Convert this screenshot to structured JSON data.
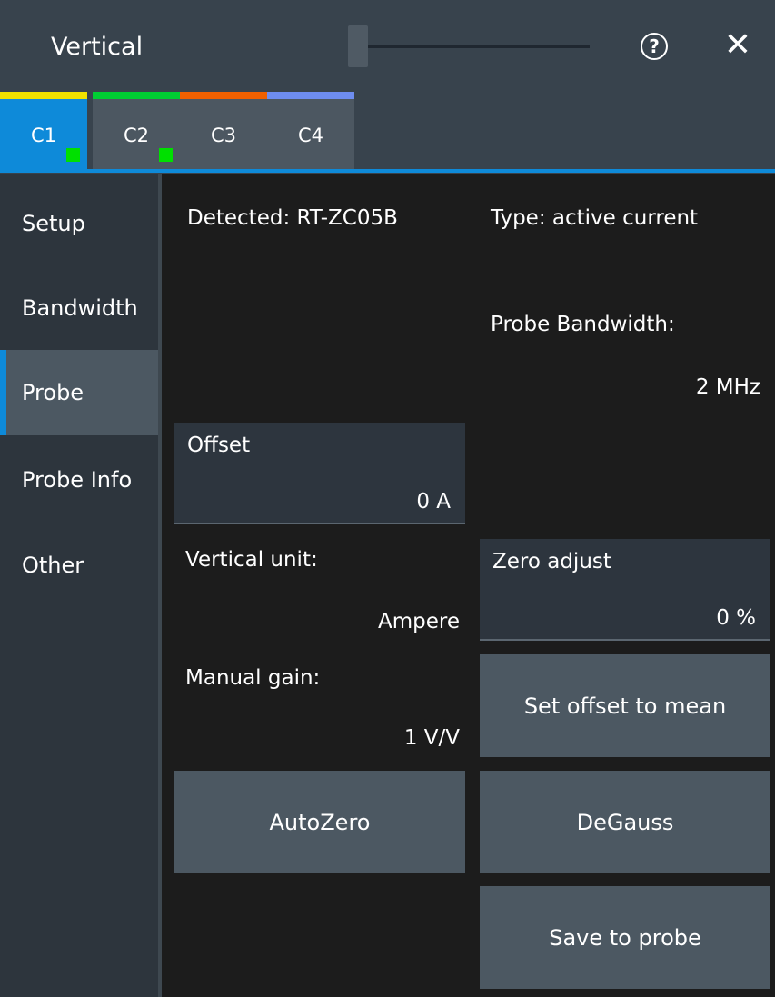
{
  "header": {
    "title": "Vertical",
    "help_glyph": "?",
    "close_glyph": "✕",
    "help_icon": "help-icon",
    "close_icon": "close-icon"
  },
  "tabs": [
    {
      "label": "C1",
      "color": "#f0e100",
      "active": true,
      "enabled": true
    },
    {
      "label": "C2",
      "color": "#00cc33",
      "active": false,
      "enabled": true
    },
    {
      "label": "C3",
      "color": "#f06000",
      "active": false,
      "enabled": false
    },
    {
      "label": "C4",
      "color": "#6e8df0",
      "active": false,
      "enabled": false
    }
  ],
  "sidebar": {
    "items": [
      {
        "label": "Setup",
        "active": false
      },
      {
        "label": "Bandwidth",
        "active": false
      },
      {
        "label": "Probe",
        "active": true
      },
      {
        "label": "Probe Info",
        "active": false
      },
      {
        "label": "Other",
        "active": false
      }
    ]
  },
  "probe": {
    "detected": "Detected:  RT-ZC05B",
    "type": "Type:  active current",
    "probe_bandwidth_label": "Probe Bandwidth:",
    "probe_bandwidth_value": "2 MHz",
    "offset": {
      "label": "Offset",
      "value": "0  A"
    },
    "vertical_unit_label": "Vertical unit:",
    "vertical_unit_value": "Ampere",
    "zero_adjust": {
      "label": "Zero adjust",
      "value": "0  %"
    },
    "manual_gain_label": "Manual gain:",
    "manual_gain_value": "1 V/V",
    "buttons": {
      "set_offset_to_mean": "Set offset to mean",
      "autozero": "AutoZero",
      "degauss": "DeGauss",
      "save_to_probe": "Save to probe"
    }
  },
  "colors": {
    "accent": "#0e8ad9",
    "indicator": "#00e000",
    "header_bg": "#38434d",
    "button_bg": "#4c5862"
  }
}
